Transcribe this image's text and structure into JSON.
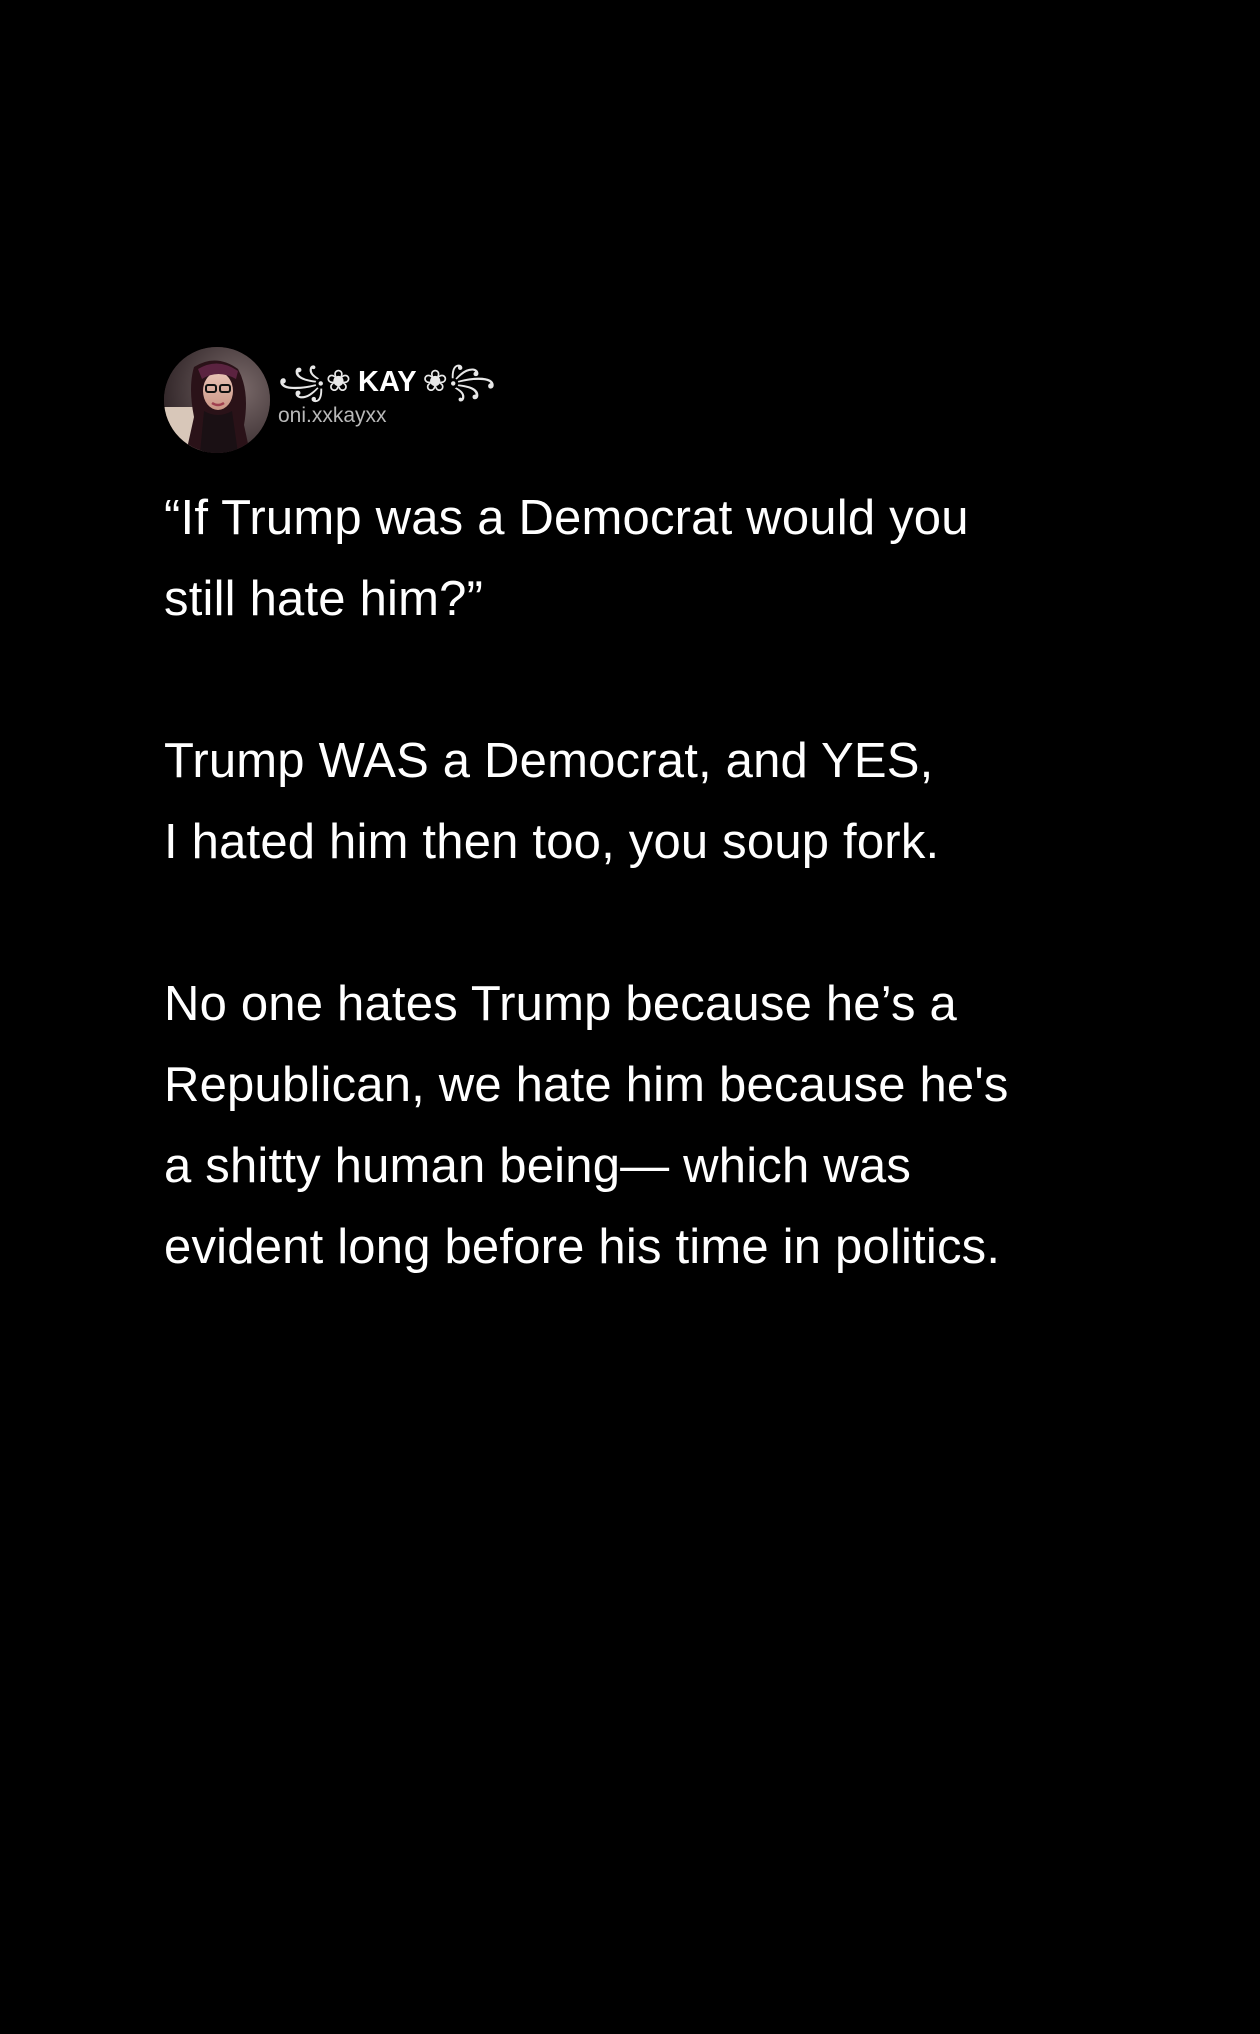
{
  "post": {
    "author": {
      "display_name": "KAY",
      "decoration_left": "꧁❀",
      "decoration_right": "❀꧂",
      "handle": "oni.xxkayxx",
      "avatar_icon": "profile-photo-avatar"
    },
    "paragraphs": [
      "“If Trump was a Democrat would you\nstill hate him?”",
      "Trump WAS a Democrat, and YES,\nI hated him then too, you soup fork.",
      "No one hates Trump because he’s a\nRepublican, we hate him because he's\na shitty human being— which was\nevident long before his time in politics."
    ]
  },
  "colors": {
    "background": "#000000",
    "text": "#ffffff",
    "handle": "#b9b9b9"
  }
}
